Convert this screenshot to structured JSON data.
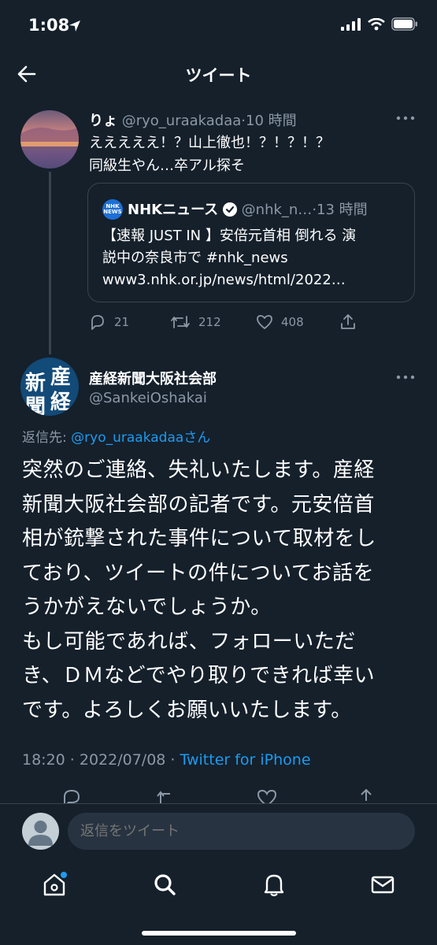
{
  "status_bar": {
    "time": "1:08"
  },
  "header": {
    "title": "ツイート"
  },
  "quoted_by": {
    "name": "りょ",
    "handle": "@ryo_uraakadaa",
    "time": "·10 時間",
    "text_line1": "えええええ！？山上徹也！？！？！？",
    "text_line2": "同級生やん…卒アル探そ"
  },
  "quote": {
    "logo_text": "NHK NEWS",
    "name": "NHKニュース",
    "handle": "@nhk_n…",
    "time": "·13 時間",
    "line1": "【速報 JUST IN 】安倍元首相 倒れる 演",
    "line2": "説中の奈良市で #nhk_news",
    "line3": "www3.nhk.or.jp/news/html/2022…"
  },
  "actions1": {
    "replies": "21",
    "retweets": "212",
    "likes": "408"
  },
  "main": {
    "avatar_chars": [
      "産",
      "経",
      "新",
      "聞"
    ],
    "name": "産経新聞大阪社会部",
    "handle": "@SankeiOshakai",
    "reply_prefix": "返信先: ",
    "reply_target": "@ryo_uraakadaa",
    "reply_suffix": "さん",
    "body_lines": [
      "突然のご連絡、失礼いたします。産経",
      "新聞大阪社会部の記者です。元安倍首",
      "相が銃撃された事件について取材をし",
      "ており、ツイートの件についてお話を",
      "うかがえないでしょうか。",
      "もし可能であれば、フォローいただ",
      "き、ＤＭなどでやり取りできれば幸い",
      "です。よろしくお願いいたします。"
    ],
    "timestamp": "18:20 · 2022/07/08 · ",
    "client": "Twitter for iPhone"
  },
  "reply_bar": {
    "placeholder": "返信をツイート"
  },
  "colors": {
    "background": "#15202b",
    "accent": "#1d9bf0",
    "muted": "#8b98a5"
  }
}
